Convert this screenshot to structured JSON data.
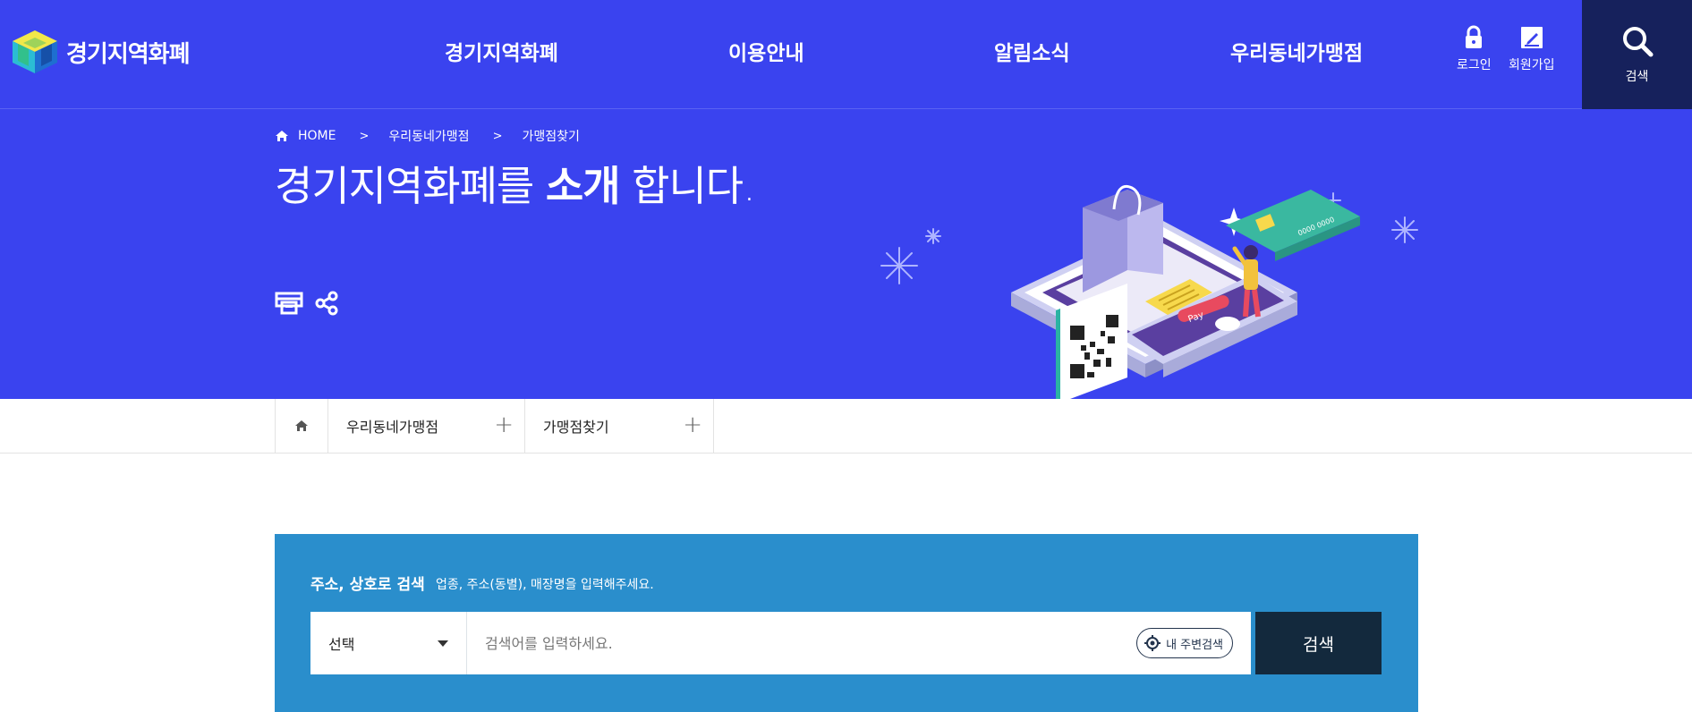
{
  "brand": {
    "name": "경기지역화폐"
  },
  "gnb": {
    "items": [
      {
        "label": "경기지역화폐"
      },
      {
        "label": "이용안내"
      },
      {
        "label": "알림소식"
      },
      {
        "label": "우리동네가맹점"
      }
    ]
  },
  "util": {
    "login": "로그인",
    "join": "회원가입",
    "search": "검색"
  },
  "breadcrumb": {
    "home": "HOME",
    "level1": "우리동네가맹점",
    "level2": "가맹점찾기",
    "separator": ">"
  },
  "hero": {
    "title_prefix": "경기지역화폐를 ",
    "title_bold": "소개",
    "title_suffix": " 합니다.",
    "illustration_pay_label": "Pay",
    "illustration_card_number": "0000 0000"
  },
  "subnav": {
    "menu1": "우리동네가맹점",
    "menu2": "가맹점찾기",
    "plus": "+"
  },
  "search": {
    "heading": "주소, 상호로 검색",
    "description": "업종, 주소(동별), 매장명을 입력해주세요.",
    "select_value": "선택",
    "input_placeholder": "검색어를 입력하세요.",
    "input_value": "",
    "nearby_label": "내 주변검색",
    "submit_label": "검색"
  },
  "colors": {
    "primary": "#3a43ef",
    "search_dark": "#16215c",
    "panel_blue": "#2a8ecc",
    "submit_dark": "#13293d"
  },
  "icons": [
    "lock-icon",
    "pen-icon",
    "search-icon",
    "home-icon",
    "print-icon",
    "share-icon",
    "location-icon",
    "chevron-right-icon",
    "caret-down-icon"
  ]
}
